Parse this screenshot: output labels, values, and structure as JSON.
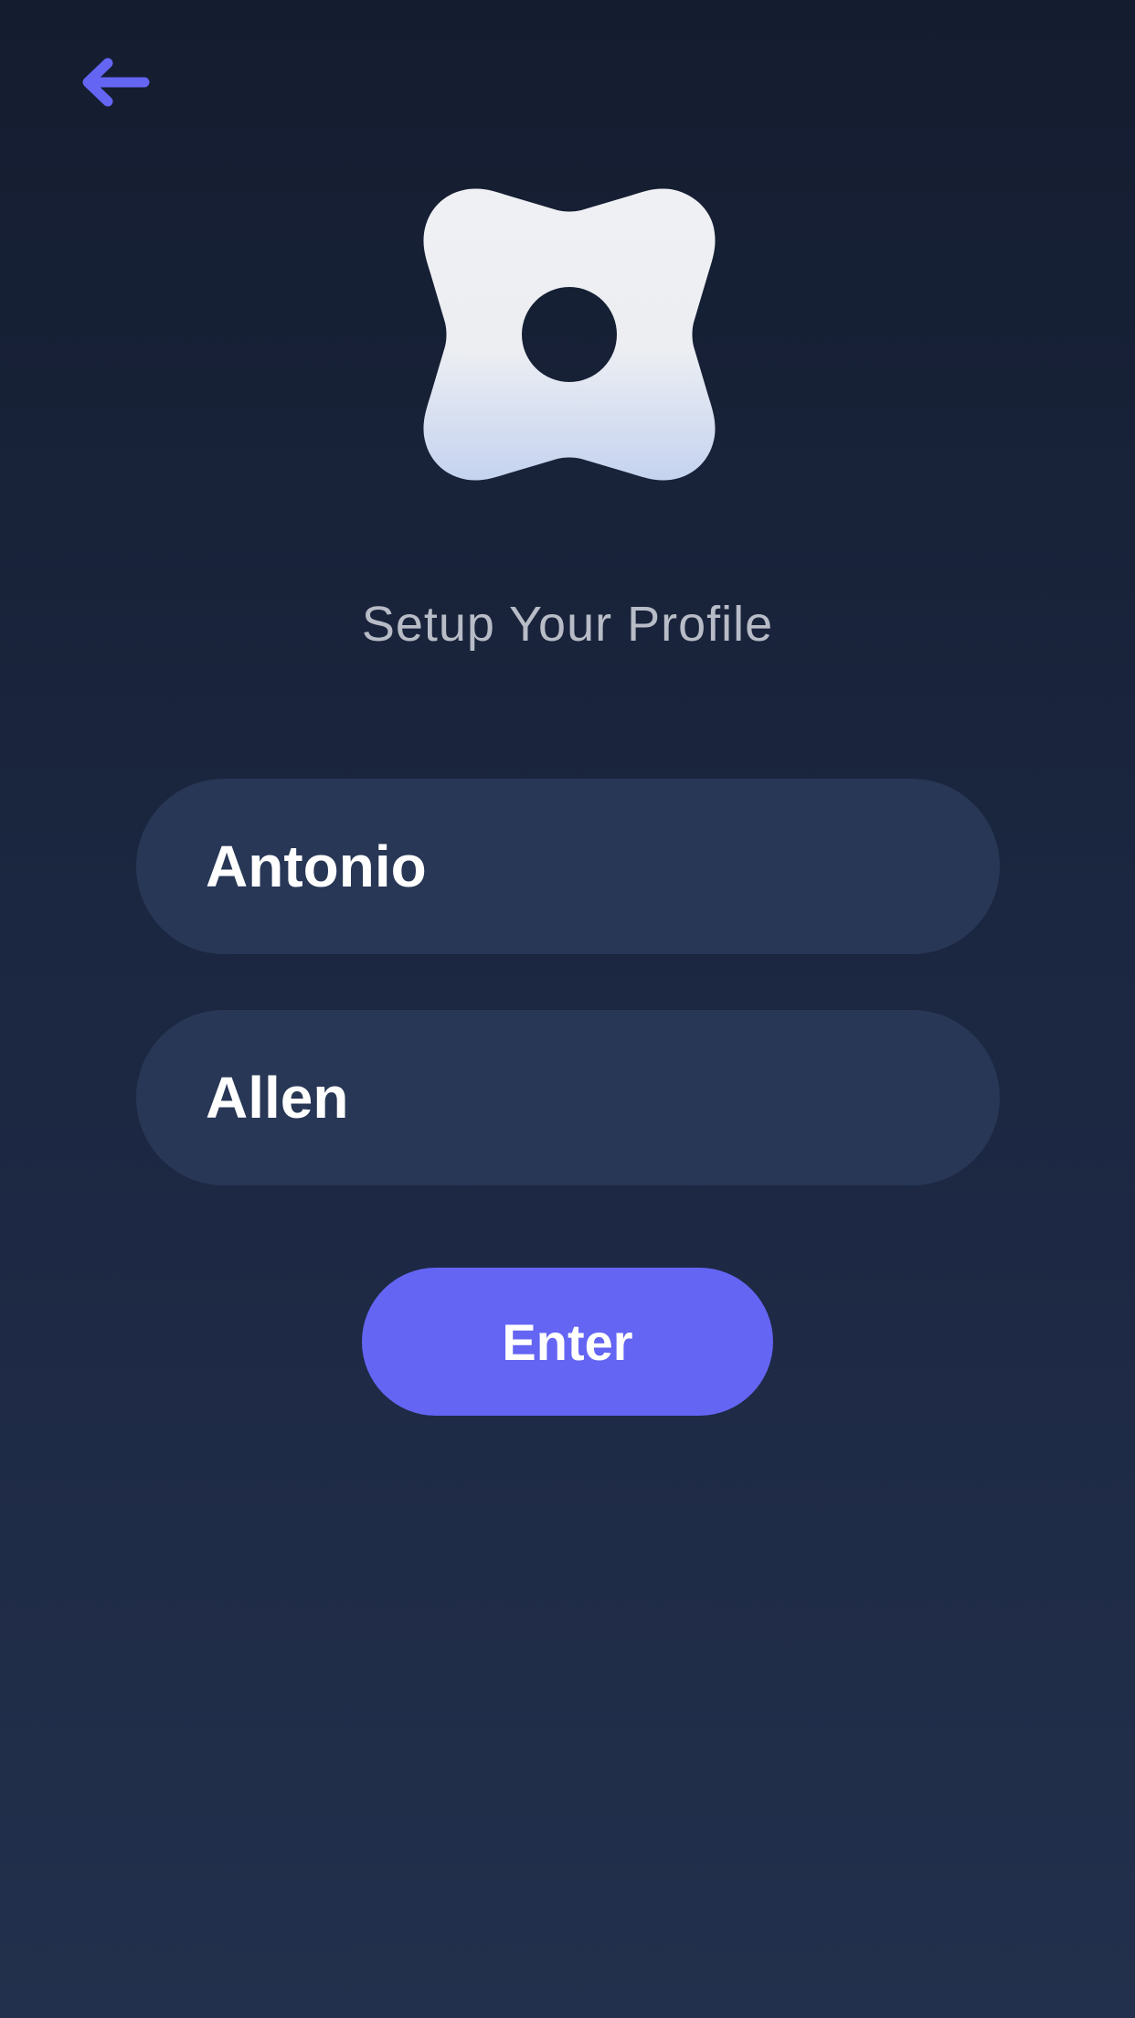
{
  "header": {
    "back_icon": "arrow-left-icon"
  },
  "logo": {
    "icon": "pinwheel-logo-icon"
  },
  "title": "Setup Your Profile",
  "form": {
    "first_name_value": "Antonio",
    "last_name_value": "Allen",
    "submit_label": "Enter"
  },
  "colors": {
    "background_top": "#141d2f",
    "background_bottom": "#22304d",
    "accent": "#6565f4",
    "field_background": "#283755",
    "title_text": "#b8bcc6",
    "field_text": "#ffffff"
  }
}
